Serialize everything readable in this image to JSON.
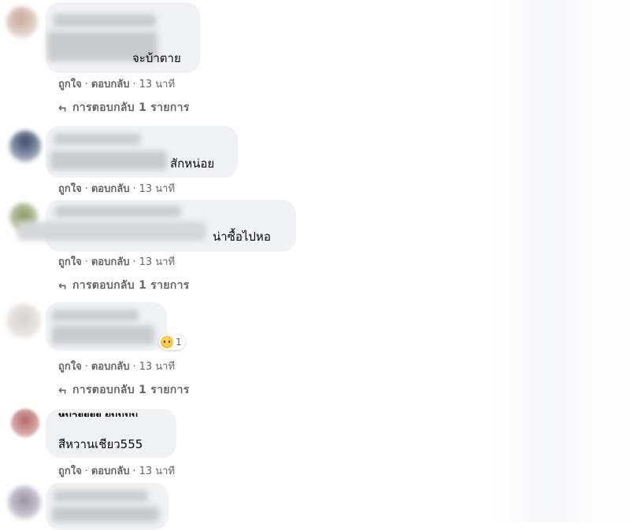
{
  "comments": [
    {
      "text": "จะบ้าตาย",
      "actions": {
        "like": "ถูกใจ",
        "reply": "ตอบกลับ",
        "time": "13 นาที"
      },
      "replies": "การตอบกลับ 1 รายการ"
    },
    {
      "text": "สักหน่อย",
      "actions": {
        "like": "ถูกใจ",
        "reply": "ตอบกลับ",
        "time": "13 นาที"
      }
    },
    {
      "text": "น่าซื้อไปหอ",
      "actions": {
        "like": "ถูกใจ",
        "reply": "ตอบกลับ",
        "time": "13 นาที"
      },
      "replies": "การตอบกลับ 1 รายการ"
    },
    {
      "reaction_icon": "sad-reaction-icon",
      "reaction_count": "1",
      "actions": {
        "like": "ถูกใจ",
        "reply": "ตอบกลับ",
        "time": "13 นาที"
      },
      "replies": "การตอบกลับ 1 รายการ"
    },
    {
      "author_partial": "หมวยยยย ผมมมม",
      "text": "สีหวานเชียว555",
      "actions": {
        "like": "ถูกใจ",
        "reply": "ตอบกลับ",
        "time": "13 นาที"
      }
    }
  ],
  "separator": "·",
  "reply_arrow": "↵",
  "colors": {
    "bubble": "#f0f2f5",
    "meta": "#65676b",
    "text": "#050505"
  }
}
